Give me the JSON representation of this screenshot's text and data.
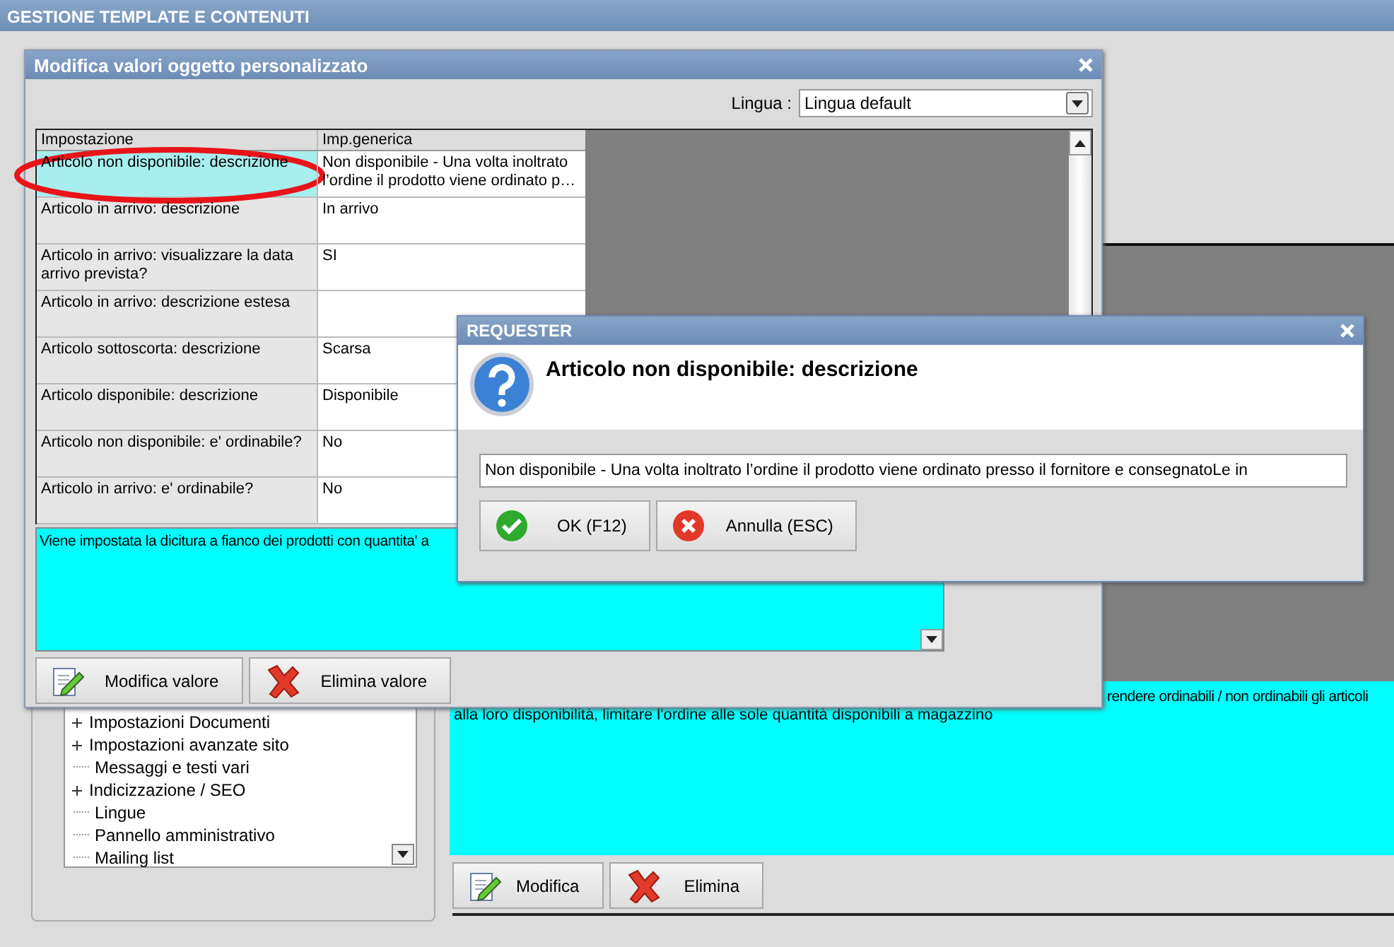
{
  "main_window": {
    "title": "GESTIONE TEMPLATE E CONTENUTI"
  },
  "tree": {
    "items": [
      {
        "label": "Impostazioni Documenti",
        "kind": "folder"
      },
      {
        "label": "Impostazioni avanzate sito",
        "kind": "folder"
      },
      {
        "label": "Messaggi e testi vari",
        "kind": "leaf"
      },
      {
        "label": "Indicizzazione / SEO",
        "kind": "folder"
      },
      {
        "label": "Lingue",
        "kind": "leaf"
      },
      {
        "label": "Pannello amministrativo",
        "kind": "leaf"
      },
      {
        "label": "Mailing list",
        "kind": "leaf"
      }
    ]
  },
  "main_description": {
    "line_1": "rendere ordinabili / non ordinabili gli articoli",
    "line_2": "alla loro disponibilità, limitare l'ordine alle sole quantità disponibili a magazzino"
  },
  "main_buttons": [
    {
      "label": "Modifica",
      "kind": "edit"
    },
    {
      "label": "Elimina",
      "kind": "delete"
    }
  ],
  "edit_dialog": {
    "title": "Modifica valori oggetto personalizzato",
    "language": {
      "label": "Lingua :",
      "value": "Lingua default"
    },
    "table": {
      "columns": [
        "Impostazione",
        "Imp.generica"
      ],
      "rows": [
        {
          "setting": "Articolo non disponibile: descrizione",
          "value": "Non disponibile - Una volta inoltrato l’ordine il prodotto viene ordinato p…",
          "selected": true
        },
        {
          "setting": "Articolo in arrivo: descrizione",
          "value": "In arrivo",
          "selected": false
        },
        {
          "setting": "Articolo in arrivo: visualizzare la data arrivo prevista?",
          "value": "SI",
          "selected": false
        },
        {
          "setting": "Articolo in arrivo: descrizione estesa",
          "selected": false
        },
        {
          "setting": "Articolo sottoscorta: descrizione",
          "value": "Scarsa",
          "selected": false
        },
        {
          "setting": "Articolo disponibile: descrizione",
          "value": "Disponibile",
          "selected": false
        },
        {
          "setting": "Articolo non disponibile: e' ordinabile?",
          "value": "No",
          "selected": false
        },
        {
          "setting": "Articolo in arrivo: e' ordinabile?",
          "value": "No",
          "selected": false
        }
      ]
    },
    "description": "Viene impostata la dicitura a fianco dei prodotti con quantita' a",
    "buttons": [
      {
        "label": "Modifica valore",
        "kind": "edit"
      },
      {
        "label": "Elimina valore",
        "kind": "delete"
      }
    ]
  },
  "requester": {
    "title": "REQUESTER",
    "heading": "Articolo non disponibile: descrizione",
    "value": "Non disponibile - Una volta inoltrato l’ordine il prodotto viene ordinato presso il fornitore e consegnatoLe in",
    "buttons": [
      {
        "label": "OK (F12)",
        "kind": "ok"
      },
      {
        "label": "Annulla (ESC)",
        "kind": "cancel"
      }
    ]
  }
}
